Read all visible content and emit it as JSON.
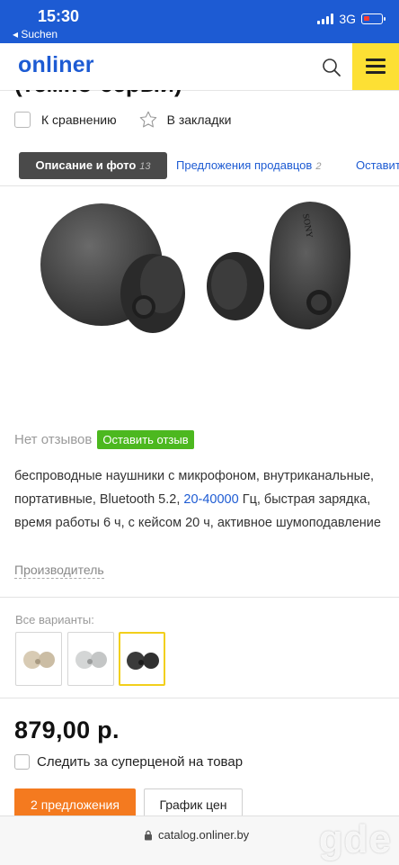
{
  "status_bar": {
    "time": "15:30",
    "back": "◂ Suchen",
    "network": "3G"
  },
  "header": {
    "logo": "onliner",
    "search_icon": "search-icon",
    "menu_icon": "hamburger-icon"
  },
  "product": {
    "title_fragment": "(темно-серый)",
    "compare_label": "К сравнению",
    "bookmark_label": "В закладки"
  },
  "tabs": [
    {
      "label": "Описание и фото",
      "count": "13"
    },
    {
      "label": "Предложения продавцов",
      "count": "2"
    },
    {
      "label": "Оставить",
      "count": ""
    }
  ],
  "reviews": {
    "none_label": "Нет отзывов",
    "leave_button": "Оставить отзыв"
  },
  "description": {
    "part1": "беспроводные наушники с микрофоном, внутриканальные, портативные, Bluetooth 5.2, ",
    "link": "20-40000",
    "part2": " Гц, быстрая зарядка, время работы 6 ч, с кейсом 20 ч, активное шумоподавление"
  },
  "manufacturer_link": "Производитель",
  "variants": {
    "label": "Все варианты:",
    "items": [
      {
        "color": "#d8cbb4",
        "selected": false
      },
      {
        "color": "#d4d6d6",
        "selected": false
      },
      {
        "color": "#3a3a3a",
        "selected": true
      }
    ]
  },
  "price": "879,00 р.",
  "follow_label": "Следить за суперценой на товар",
  "buttons": {
    "offers": "2 предложения",
    "price_chart": "График цен"
  },
  "url": "catalog.onliner.by",
  "watermark": "gde",
  "photo_brand": "SONY"
}
